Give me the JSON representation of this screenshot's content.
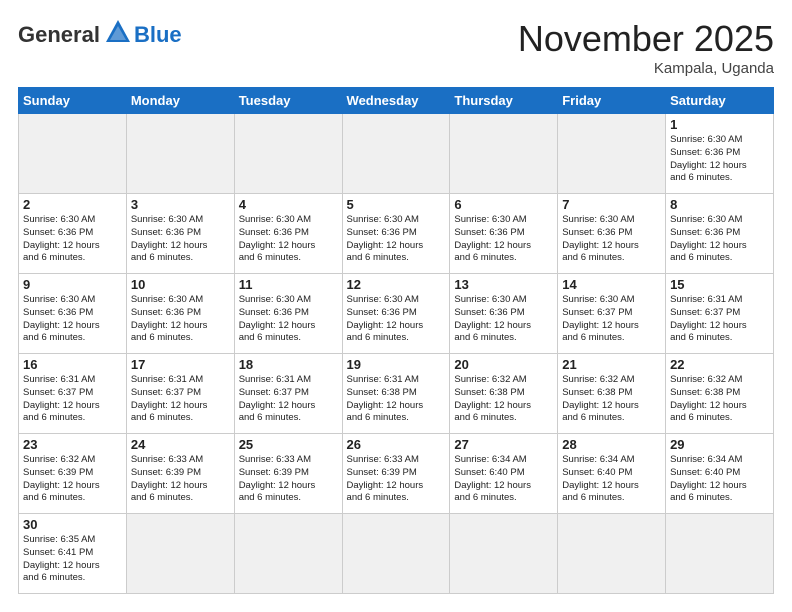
{
  "header": {
    "logo_general": "General",
    "logo_blue": "Blue",
    "month_title": "November 2025",
    "location": "Kampala, Uganda"
  },
  "weekdays": [
    "Sunday",
    "Monday",
    "Tuesday",
    "Wednesday",
    "Thursday",
    "Friday",
    "Saturday"
  ],
  "weeks": [
    [
      {
        "day": "",
        "info": ""
      },
      {
        "day": "",
        "info": ""
      },
      {
        "day": "",
        "info": ""
      },
      {
        "day": "",
        "info": ""
      },
      {
        "day": "",
        "info": ""
      },
      {
        "day": "",
        "info": ""
      },
      {
        "day": "1",
        "info": "Sunrise: 6:30 AM\nSunset: 6:36 PM\nDaylight: 12 hours\nand 6 minutes."
      }
    ],
    [
      {
        "day": "2",
        "info": "Sunrise: 6:30 AM\nSunset: 6:36 PM\nDaylight: 12 hours\nand 6 minutes."
      },
      {
        "day": "3",
        "info": "Sunrise: 6:30 AM\nSunset: 6:36 PM\nDaylight: 12 hours\nand 6 minutes."
      },
      {
        "day": "4",
        "info": "Sunrise: 6:30 AM\nSunset: 6:36 PM\nDaylight: 12 hours\nand 6 minutes."
      },
      {
        "day": "5",
        "info": "Sunrise: 6:30 AM\nSunset: 6:36 PM\nDaylight: 12 hours\nand 6 minutes."
      },
      {
        "day": "6",
        "info": "Sunrise: 6:30 AM\nSunset: 6:36 PM\nDaylight: 12 hours\nand 6 minutes."
      },
      {
        "day": "7",
        "info": "Sunrise: 6:30 AM\nSunset: 6:36 PM\nDaylight: 12 hours\nand 6 minutes."
      },
      {
        "day": "8",
        "info": "Sunrise: 6:30 AM\nSunset: 6:36 PM\nDaylight: 12 hours\nand 6 minutes."
      }
    ],
    [
      {
        "day": "9",
        "info": "Sunrise: 6:30 AM\nSunset: 6:36 PM\nDaylight: 12 hours\nand 6 minutes."
      },
      {
        "day": "10",
        "info": "Sunrise: 6:30 AM\nSunset: 6:36 PM\nDaylight: 12 hours\nand 6 minutes."
      },
      {
        "day": "11",
        "info": "Sunrise: 6:30 AM\nSunset: 6:36 PM\nDaylight: 12 hours\nand 6 minutes."
      },
      {
        "day": "12",
        "info": "Sunrise: 6:30 AM\nSunset: 6:36 PM\nDaylight: 12 hours\nand 6 minutes."
      },
      {
        "day": "13",
        "info": "Sunrise: 6:30 AM\nSunset: 6:36 PM\nDaylight: 12 hours\nand 6 minutes."
      },
      {
        "day": "14",
        "info": "Sunrise: 6:30 AM\nSunset: 6:37 PM\nDaylight: 12 hours\nand 6 minutes."
      },
      {
        "day": "15",
        "info": "Sunrise: 6:31 AM\nSunset: 6:37 PM\nDaylight: 12 hours\nand 6 minutes."
      }
    ],
    [
      {
        "day": "16",
        "info": "Sunrise: 6:31 AM\nSunset: 6:37 PM\nDaylight: 12 hours\nand 6 minutes."
      },
      {
        "day": "17",
        "info": "Sunrise: 6:31 AM\nSunset: 6:37 PM\nDaylight: 12 hours\nand 6 minutes."
      },
      {
        "day": "18",
        "info": "Sunrise: 6:31 AM\nSunset: 6:37 PM\nDaylight: 12 hours\nand 6 minutes."
      },
      {
        "day": "19",
        "info": "Sunrise: 6:31 AM\nSunset: 6:38 PM\nDaylight: 12 hours\nand 6 minutes."
      },
      {
        "day": "20",
        "info": "Sunrise: 6:32 AM\nSunset: 6:38 PM\nDaylight: 12 hours\nand 6 minutes."
      },
      {
        "day": "21",
        "info": "Sunrise: 6:32 AM\nSunset: 6:38 PM\nDaylight: 12 hours\nand 6 minutes."
      },
      {
        "day": "22",
        "info": "Sunrise: 6:32 AM\nSunset: 6:38 PM\nDaylight: 12 hours\nand 6 minutes."
      }
    ],
    [
      {
        "day": "23",
        "info": "Sunrise: 6:32 AM\nSunset: 6:39 PM\nDaylight: 12 hours\nand 6 minutes."
      },
      {
        "day": "24",
        "info": "Sunrise: 6:33 AM\nSunset: 6:39 PM\nDaylight: 12 hours\nand 6 minutes."
      },
      {
        "day": "25",
        "info": "Sunrise: 6:33 AM\nSunset: 6:39 PM\nDaylight: 12 hours\nand 6 minutes."
      },
      {
        "day": "26",
        "info": "Sunrise: 6:33 AM\nSunset: 6:39 PM\nDaylight: 12 hours\nand 6 minutes."
      },
      {
        "day": "27",
        "info": "Sunrise: 6:34 AM\nSunset: 6:40 PM\nDaylight: 12 hours\nand 6 minutes."
      },
      {
        "day": "28",
        "info": "Sunrise: 6:34 AM\nSunset: 6:40 PM\nDaylight: 12 hours\nand 6 minutes."
      },
      {
        "day": "29",
        "info": "Sunrise: 6:34 AM\nSunset: 6:40 PM\nDaylight: 12 hours\nand 6 minutes."
      }
    ],
    [
      {
        "day": "30",
        "info": "Sunrise: 6:35 AM\nSunset: 6:41 PM\nDaylight: 12 hours\nand 6 minutes."
      },
      {
        "day": "",
        "info": ""
      },
      {
        "day": "",
        "info": ""
      },
      {
        "day": "",
        "info": ""
      },
      {
        "day": "",
        "info": ""
      },
      {
        "day": "",
        "info": ""
      },
      {
        "day": "",
        "info": ""
      }
    ]
  ]
}
